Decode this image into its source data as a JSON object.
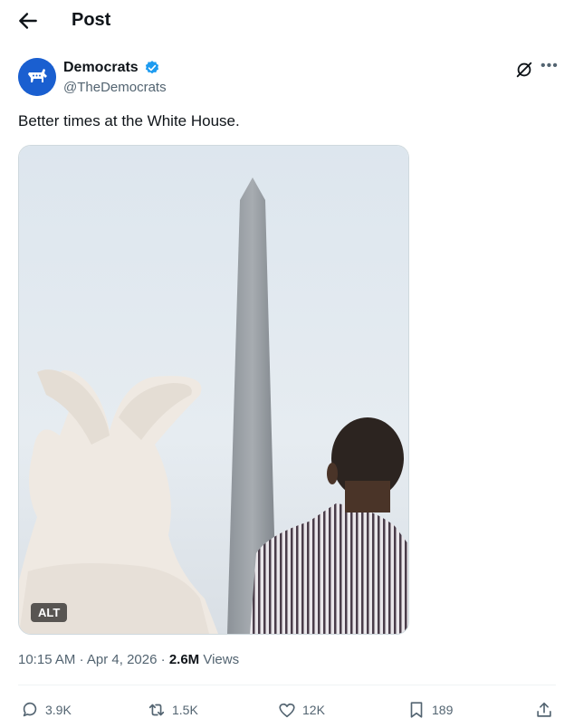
{
  "header": {
    "title": "Post"
  },
  "author": {
    "name": "Democrats",
    "handle": "@TheDemocrats"
  },
  "post": {
    "text": "Better times at the White House.",
    "alt_label": "ALT",
    "time": "10:15 AM",
    "date": "Apr 4, 2026",
    "views_count": "2.6M",
    "views_label": "Views"
  },
  "actions": {
    "replies": "3.9K",
    "reposts": "1.5K",
    "likes": "12K",
    "bookmarks": "189"
  },
  "colors": {
    "accent": "#1d9bf0",
    "avatar_bg": "#1a5fd0",
    "muted": "#536471"
  },
  "icons": [
    "back-arrow-icon",
    "donkey-logo-icon",
    "verified-badge-icon",
    "grok-icon",
    "more-icon",
    "reply-icon",
    "repost-icon",
    "like-icon",
    "bookmark-icon",
    "share-icon"
  ]
}
